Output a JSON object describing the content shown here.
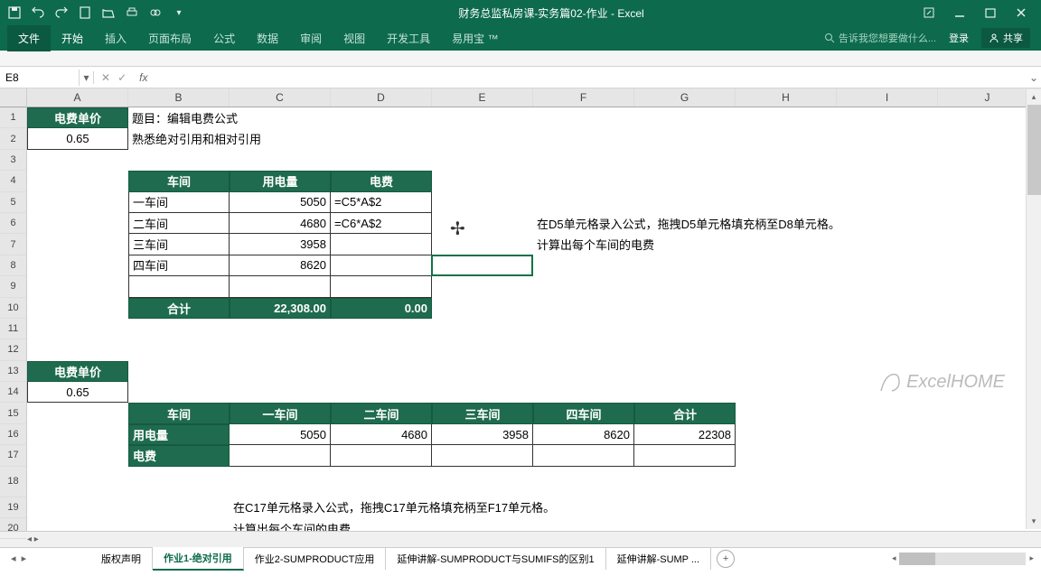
{
  "title": "财务总监私房课-实务篇02-作业 - Excel",
  "qa": [
    "save",
    "undo",
    "redo",
    "new",
    "open",
    "print",
    "touch",
    "more"
  ],
  "tabs": {
    "file": "文件",
    "items": [
      "开始",
      "插入",
      "页面布局",
      "公式",
      "数据",
      "审阅",
      "视图",
      "开发工具",
      "易用宝 ™"
    ]
  },
  "tellme": "告诉我您想要做什么...",
  "login": "登录",
  "share": "共享",
  "namebox": "E8",
  "cols": [
    "A",
    "B",
    "C",
    "D",
    "E",
    "F",
    "G",
    "H",
    "I",
    "J"
  ],
  "rows_count": 20,
  "data": {
    "A1": "电费单价",
    "B1": "题目：编辑电费公式",
    "A2": "0.65",
    "B2": "熟悉绝对引用和相对引用",
    "B4": "车间",
    "C4": "用电量",
    "D4": "电费",
    "B5": "一车间",
    "C5": "5050",
    "D5": "=C5*A$2",
    "B6": "二车间",
    "C6": "4680",
    "D6": "=C6*A$2",
    "F6": "在D5单元格录入公式，拖拽D5单元格填充柄至D8单元格。",
    "B7": "三车间",
    "C7": "3958",
    "F7": "计算出每个车间的电费",
    "B8": "四车间",
    "C8": "8620",
    "B10": "合计",
    "C10": "22,308.00",
    "D10": "0.00",
    "A13": "电费单价",
    "A14": "0.65",
    "B15": "车间",
    "C15": "一车间",
    "D15": "二车间",
    "E15": "三车间",
    "F15": "四车间",
    "G15": "合计",
    "B16": "用电量",
    "C16": "5050",
    "D16": "4680",
    "E16": "3958",
    "F16": "8620",
    "G16": "22308",
    "B17": "电费",
    "C19": "在C17单元格录入公式，拖拽C17单元格填充柄至F17单元格。",
    "C20": "计算出每个车间的电费"
  },
  "watermark": "ExcelHOME",
  "sheets": {
    "active": 1,
    "items": [
      "版权声明",
      "作业1-绝对引用",
      "作业2-SUMPRODUCT应用",
      "延伸讲解-SUMPRODUCT与SUMIFS的区别1",
      "延伸讲解-SUMP ..."
    ]
  }
}
